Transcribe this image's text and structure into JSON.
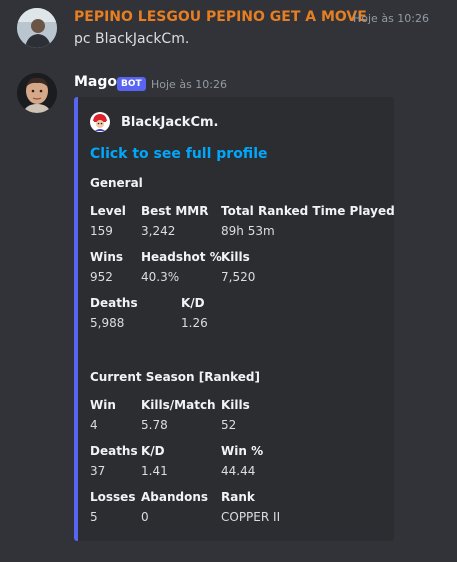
{
  "messages": [
    {
      "username": "PEPINO LESGOU PEPINO GET A MOVE",
      "username_color": "#e67e22",
      "timestamp": "Hoje às 10:26",
      "text": "pc BlackJackCm."
    },
    {
      "username": "Mago",
      "username_color": "#ffffff",
      "bot_tag": "BOT",
      "timestamp": "Hoje às 10:26",
      "embed": {
        "accent_color": "#5865f2",
        "author": "BlackJackCm.",
        "title": "Click to see full profile",
        "sections": [
          {
            "title": "General",
            "rows": [
              [
                {
                  "name": "Level",
                  "value": "159"
                },
                {
                  "name": "Best MMR",
                  "value": "3,242"
                },
                {
                  "name": "Total Ranked Time Played",
                  "value": "89h 53m"
                }
              ],
              [
                {
                  "name": "Wins",
                  "value": "952"
                },
                {
                  "name": "Headshot %",
                  "value": "40.3%"
                },
                {
                  "name": "Kills",
                  "value": "7,520"
                }
              ],
              [
                {
                  "name": "Deaths",
                  "value": "5,988"
                },
                {
                  "name": "K/D",
                  "value": "1.26"
                }
              ]
            ]
          },
          {
            "title": "Current Season [Ranked]",
            "rows": [
              [
                {
                  "name": "Win",
                  "value": "4"
                },
                {
                  "name": "Kills/Match",
                  "value": "5.78"
                },
                {
                  "name": "Kills",
                  "value": "52"
                }
              ],
              [
                {
                  "name": "Deaths",
                  "value": "37"
                },
                {
                  "name": "K/D",
                  "value": "1.41"
                },
                {
                  "name": "Win %",
                  "value": "44.44"
                }
              ],
              [
                {
                  "name": "Losses",
                  "value": "5"
                },
                {
                  "name": "Abandons",
                  "value": "0"
                },
                {
                  "name": "Rank",
                  "value": "COPPER II"
                }
              ]
            ]
          }
        ]
      }
    }
  ]
}
